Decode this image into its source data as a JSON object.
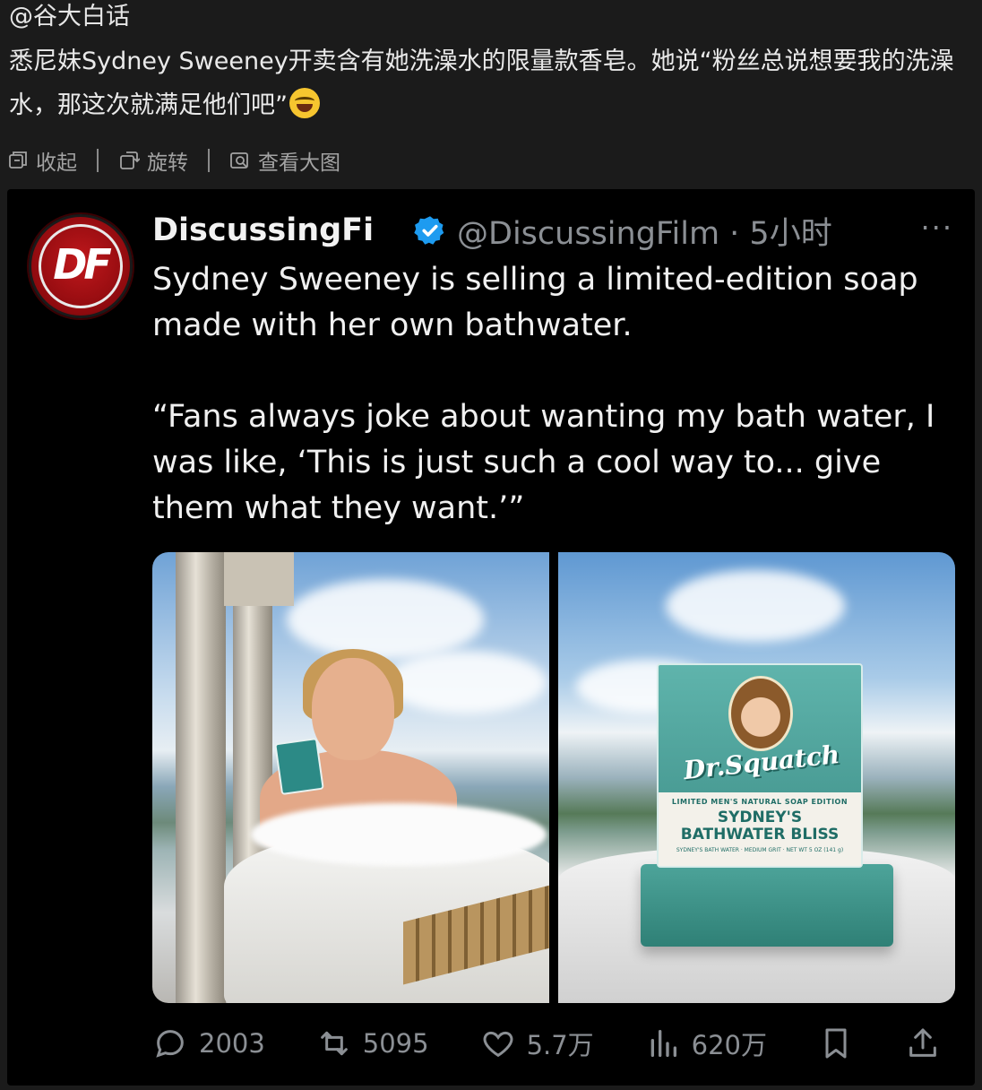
{
  "weibo": {
    "author": "@谷大白话",
    "text": "悉尼妹Sydney Sweeney开卖含有她洗澡水的限量款香皂。她说“粉丝总说想要我的洗澡水，那这次就满足他们吧”",
    "emoji": "grinning-tears-emoji",
    "actions": [
      {
        "label": "收起",
        "icon": "collapse-icon"
      },
      {
        "label": "旋转",
        "icon": "rotate-icon"
      },
      {
        "label": "查看大图",
        "icon": "view-large-icon"
      }
    ]
  },
  "tweet": {
    "avatar_text": "DF",
    "display_name": "DiscussingFi",
    "verified": true,
    "handle": "@DiscussingFilm · 5小时",
    "more": "···",
    "text": "Sydney Sweeney is selling a limited-edition soap made with her own bathwater.\n\n“Fans always joke about wanting my bath water, I was like, ‘This is just such a cool way to... give them what they want.’”",
    "product": {
      "brand": "Dr.Squatch",
      "top_line": "LIMITED   MEN'S NATURAL SOAP   EDITION",
      "title_line1": "SYDNEY'S",
      "title_line2": "BATHWATER BLISS",
      "foot": "SYDNEY'S BATH WATER · MEDIUM GRIT · NET WT 5 OZ (141 g)"
    },
    "stats": {
      "replies": "2003",
      "retweets": "5095",
      "likes": "5.7万",
      "views": "620万"
    },
    "colors": {
      "verified_blue": "#1d9bf0",
      "avatar_red": "#b8141a",
      "soap_teal": "#3e8f88"
    }
  }
}
